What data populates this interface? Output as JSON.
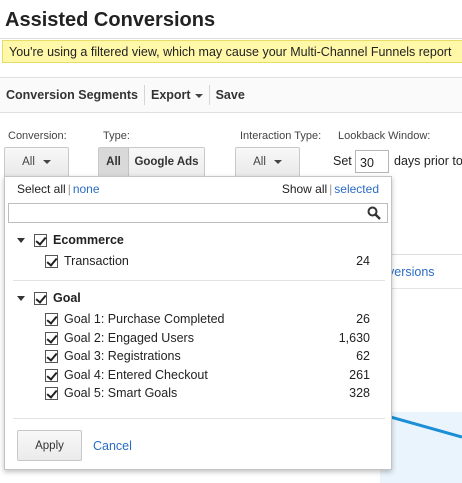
{
  "page": {
    "title": "Assisted Conversions",
    "warning": "You're using a filtered view, which may cause your Multi-Channel Funnels report"
  },
  "toolbar": {
    "conversion_segments": "Conversion Segments",
    "export": "Export",
    "save": "Save"
  },
  "filters": {
    "conversion_label": "Conversion:",
    "conversion_value": "All",
    "type_label": "Type:",
    "type_all": "All",
    "type_google_ads": "Google Ads",
    "interaction_label": "Interaction Type:",
    "interaction_value": "All",
    "lookback_label": "Lookback Window:",
    "set_label": "Set",
    "lookback_days": "30",
    "days_suffix": "days prior to"
  },
  "background": {
    "link_fragment": "versions"
  },
  "dropdown": {
    "select_all": "Select all",
    "none": "none",
    "show_all": "Show all",
    "selected": "selected",
    "separator": "|",
    "search_value": "",
    "groups": [
      {
        "name": "Ecommerce",
        "items": [
          {
            "label": "Transaction",
            "count": "24"
          }
        ]
      },
      {
        "name": "Goal",
        "items": [
          {
            "label": "Goal 1: Purchase Completed",
            "count": "26"
          },
          {
            "label": "Goal 2: Engaged Users",
            "count": "1,630"
          },
          {
            "label": "Goal 3: Registrations",
            "count": "62"
          },
          {
            "label": "Goal 4: Entered Checkout",
            "count": "261"
          },
          {
            "label": "Goal 5: Smart Goals",
            "count": "328"
          }
        ]
      }
    ],
    "apply": "Apply",
    "cancel": "Cancel"
  },
  "colors": {
    "link": "#2b6cc4",
    "warning_bg": "#fff8a8",
    "chart_line": "#1a8fd6"
  }
}
